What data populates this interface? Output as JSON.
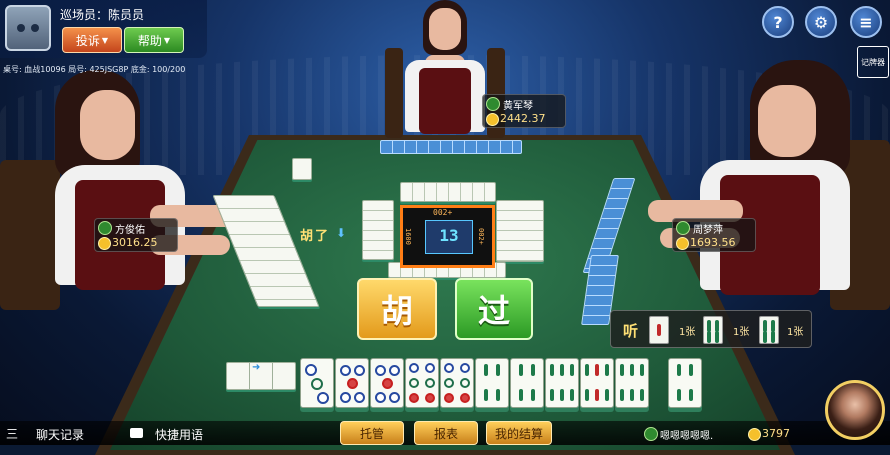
{
  "header": {
    "staff_label": "巡场员：陈员员",
    "complaint_button": "投诉",
    "help_button": "帮助",
    "room_info": "桌号: 血战10096  局号: 425JSG8P      底金: 100/200",
    "record_label": "记牌器"
  },
  "icons": {
    "help": "?",
    "settings": "⚙",
    "menu": "≡"
  },
  "players": {
    "top": {
      "name": "黄军琴",
      "score": "2442.37"
    },
    "left": {
      "name": "方俊佑",
      "score": "3016.25"
    },
    "right": {
      "name": "周梦萍",
      "score": "1693.56"
    },
    "self": {
      "name": "嗯嗯嗯嗯嗯.",
      "score": "3797"
    }
  },
  "compass": {
    "number": "13",
    "top_score": "002+",
    "left_score": "1600",
    "right_score": "002+"
  },
  "actions": {
    "hu": "胡",
    "guo": "过",
    "hu_le": "胡了"
  },
  "ting": {
    "label": "听",
    "counts": [
      "1张",
      "1张",
      "1张"
    ]
  },
  "bottom": {
    "menu_icon": "三",
    "chat_log": "聊天记录",
    "quick_chat": "快捷用语",
    "tuoguan": "托管",
    "report": "报表",
    "my_settlement": "我的结算"
  }
}
